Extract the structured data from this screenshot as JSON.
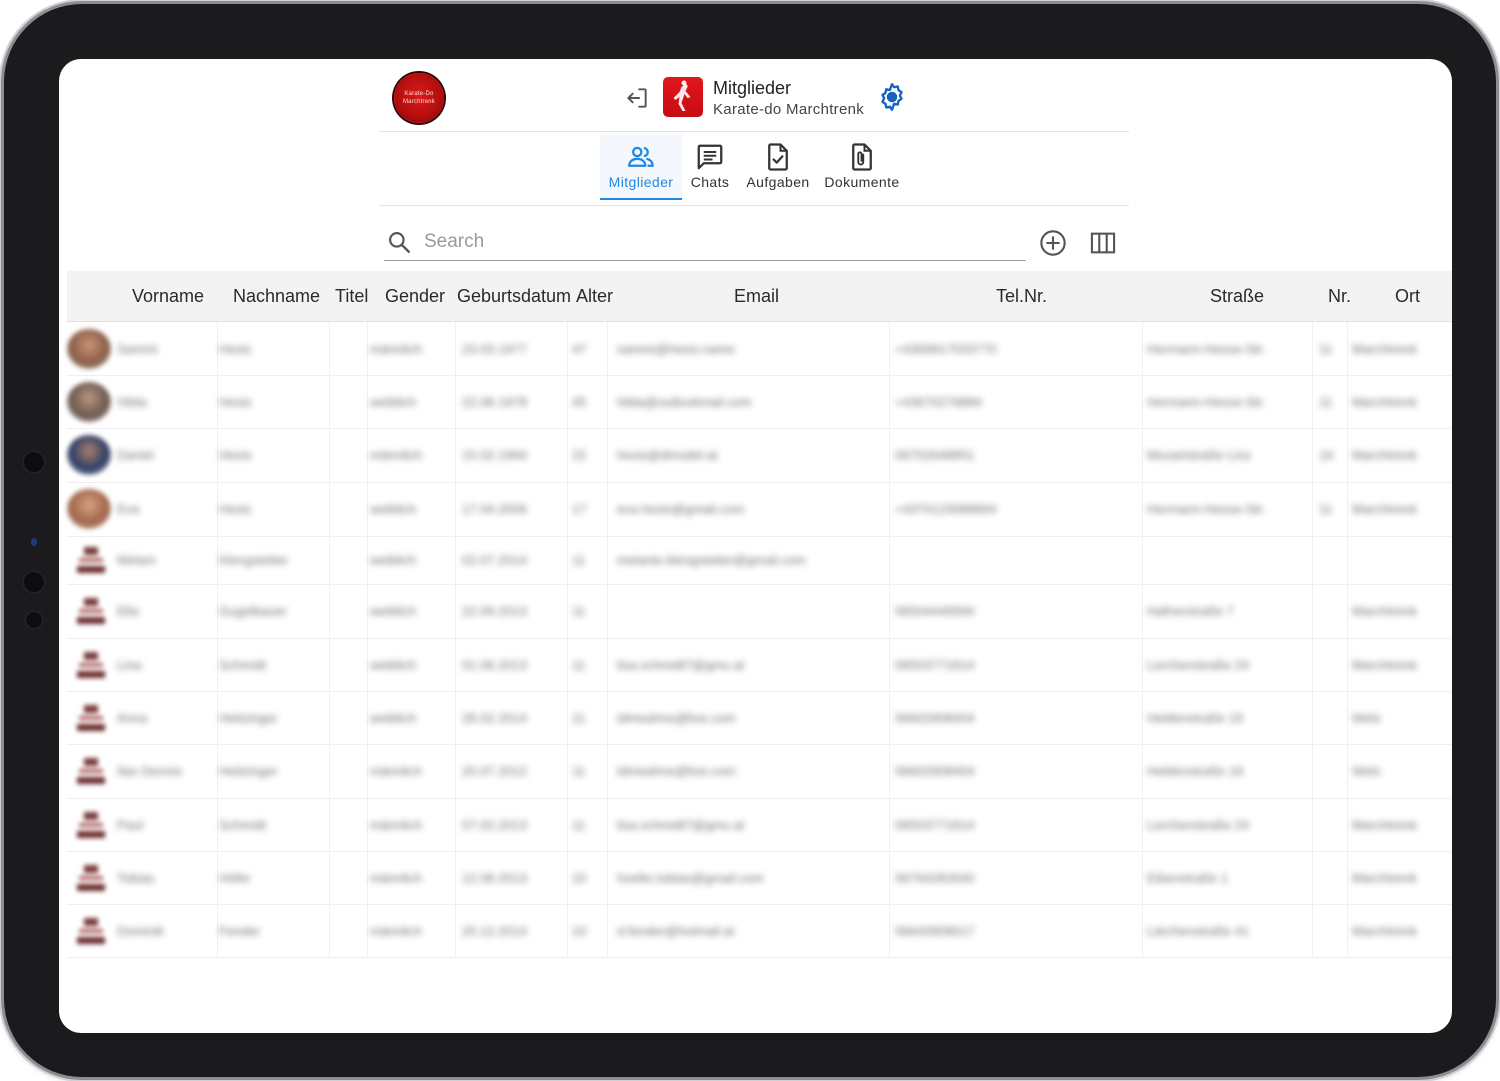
{
  "header": {
    "club_logo_text": "Karate-Do Marchtrenk",
    "org_title": "Mitglieder",
    "org_subtitle": "Karate-do Marchtrenk"
  },
  "tabs": [
    {
      "label": "Mitglieder",
      "icon": "people-icon",
      "active": true
    },
    {
      "label": "Chats",
      "icon": "chat-icon",
      "active": false
    },
    {
      "label": "Aufgaben",
      "icon": "task-file-icon",
      "active": false
    },
    {
      "label": "Dokumente",
      "icon": "attachment-file-icon",
      "active": false
    }
  ],
  "search": {
    "placeholder": "Search",
    "value": ""
  },
  "colors": {
    "accent": "#1e88e5",
    "brand": "#c50d12",
    "header_bg": "#f3f3f3"
  },
  "table": {
    "columns": [
      "Vorname",
      "Nachname",
      "Titel",
      "Gender",
      "Geburtsdatum",
      "Alter",
      "Email",
      "Tel.Nr.",
      "Straße",
      "Nr.",
      "Ort"
    ],
    "rows": [
      {
        "avatar": "photo-1",
        "vorname": "Sammi",
        "nachname": "Hesis",
        "gender": "männlich",
        "geburtsdatum": "23.03.1977",
        "alter": "47",
        "email": "sammi@hesis.name",
        "tel": "+4369917033770",
        "strasse": "Hermann-Hesse-Str.",
        "nr": "11",
        "ort": "Marchtrenk"
      },
      {
        "avatar": "photo-2",
        "vorname": "Hilda",
        "nachname": "Hesis",
        "gender": "weiblich",
        "geburtsdatum": "22.08.1978",
        "alter": "45",
        "email": "hilda@outlookmail.com",
        "tel": "+43670276884",
        "strasse": "Hermann-Hesse-Str.",
        "nr": "11",
        "ort": "Marchtrenk"
      },
      {
        "avatar": "photo-3",
        "vorname": "Daniel",
        "nachname": "Hesis",
        "gender": "männlich",
        "geburtsdatum": "15.02.1994",
        "alter": "22",
        "email": "hesis@dmodel.at",
        "tel": "06702648851",
        "strasse": "Mozartstraße Linz",
        "nr": "16",
        "ort": "Marchtrenk"
      },
      {
        "avatar": "photo-4",
        "vorname": "Eva",
        "nachname": "Hesis",
        "gender": "weiblich",
        "geburtsdatum": "17.04.2006",
        "alter": "17",
        "email": "eva.hesis@gmail.com",
        "tel": "+4370123088894",
        "strasse": "Hermann-Hesse-Str.",
        "nr": "11",
        "ort": "Marchtrenk"
      },
      {
        "avatar": "placeholder",
        "vorname": "Melani",
        "nachname": "Klengstetter",
        "gender": "weiblich",
        "geburtsdatum": "02.07.2014",
        "alter": "11",
        "email": "melanie.klengstetter@gmail.com",
        "tel": "",
        "strasse": "",
        "nr": "",
        "ort": ""
      },
      {
        "avatar": "placeholder",
        "vorname": "Ella",
        "nachname": "Gugelbauer",
        "gender": "weiblich",
        "geburtsdatum": "22.09.2013",
        "alter": "11",
        "email": "",
        "tel": "06504449584",
        "strasse": "Hafnerstraße 7",
        "nr": "",
        "ort": "Marchtrenk"
      },
      {
        "avatar": "placeholder",
        "vorname": "Lina",
        "nachname": "Schmidt",
        "gender": "weiblich",
        "geburtsdatum": "01.06.2013",
        "alter": "11",
        "email": "lisa.schmidt7@gmx.at",
        "tel": "06503771814",
        "strasse": "Lerchenstraße 24",
        "nr": "",
        "ort": "Marchtrenk"
      },
      {
        "avatar": "placeholder",
        "vorname": "Anna",
        "nachname": "Heitzinger",
        "gender": "weiblich",
        "geburtsdatum": "28.02.2014",
        "alter": "11",
        "email": "tdmeahne@live.com",
        "tel": "06602908404",
        "strasse": "Heldenstraße 19",
        "nr": "",
        "ort": "Wels"
      },
      {
        "avatar": "placeholder",
        "vorname": "Ilan Dennis",
        "nachname": "Heitzinger",
        "gender": "männlich",
        "geburtsdatum": "20.07.2012",
        "alter": "11",
        "email": "tdmeahne@live.com",
        "tel": "06602908404",
        "strasse": "Heldenstraße 19",
        "nr": "",
        "ort": "Wels"
      },
      {
        "avatar": "placeholder",
        "vorname": "Paul",
        "nachname": "Schmidt",
        "gender": "männlich",
        "geburtsdatum": "07.02.2013",
        "alter": "11",
        "email": "lisa.schmidt7@gmx.at",
        "tel": "06503771814",
        "strasse": "Lerchenstraße 24",
        "nr": "",
        "ort": "Marchtrenk"
      },
      {
        "avatar": "placeholder",
        "vorname": "Tobias",
        "nachname": "Höfer",
        "gender": "männlich",
        "geburtsdatum": "12.08.2013",
        "alter": "10",
        "email": "hoefer.tobias@gmail.com",
        "tel": "06764282640",
        "strasse": "Eibenstraße 1",
        "nr": "",
        "ort": "Marchtrenk"
      },
      {
        "avatar": "placeholder",
        "vorname": "Dominik",
        "nachname": "Fender",
        "gender": "männlich",
        "geburtsdatum": "20.12.2014",
        "alter": "10",
        "email": "d.fender@hotmail.at",
        "tel": "06643908017",
        "strasse": "Lärchenstraße 41",
        "nr": "",
        "ort": "Marchtrenk"
      }
    ]
  }
}
